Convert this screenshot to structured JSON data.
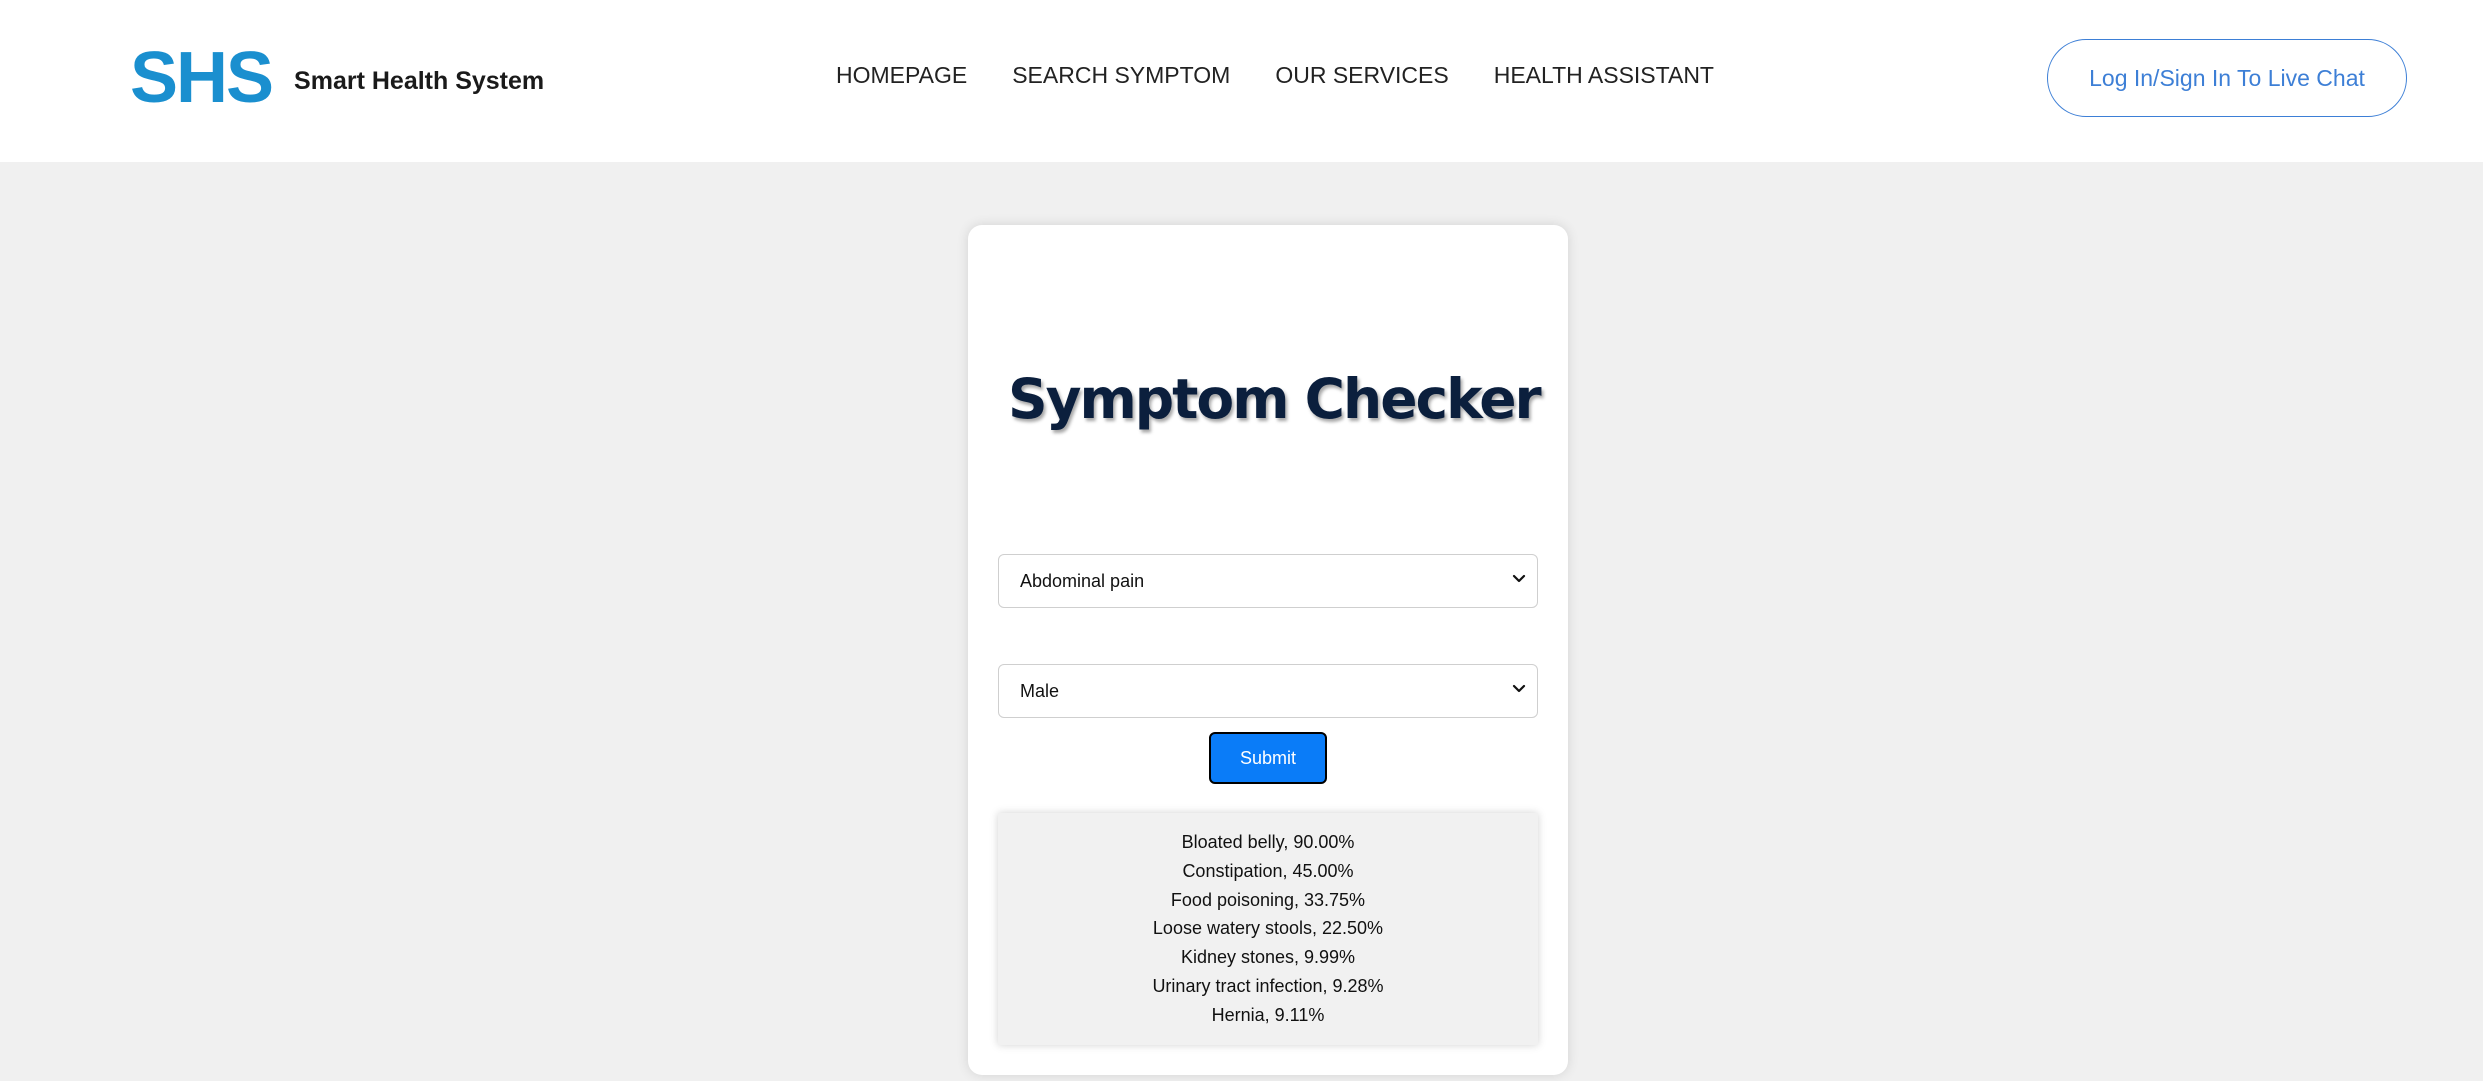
{
  "header": {
    "logo_mark": "SHS",
    "logo_text": "Smart Health System",
    "nav": [
      "HOMEPAGE",
      "SEARCH SYMPTOM",
      "OUR SERVICES",
      "HEALTH ASSISTANT"
    ],
    "login_label": "Log In/Sign In To Live Chat"
  },
  "checker": {
    "title": "Symptom Checker",
    "symptom_selected": "Abdominal pain",
    "gender_selected": "Male",
    "submit_label": "Submit",
    "results": [
      "Bloated belly, 90.00%",
      "Constipation, 45.00%",
      "Food poisoning, 33.75%",
      "Loose watery stools, 22.50%",
      "Kidney stones, 9.99%",
      "Urinary tract infection, 9.28%",
      "Hernia, 9.11%"
    ]
  },
  "icons": {
    "dropdown": "chevron-down-icon"
  },
  "colors": {
    "brand_blue": "#1a8fcf",
    "link_blue": "#3d7fd6",
    "submit_blue": "#0a7cf8",
    "title_navy": "#0b1f3d",
    "page_bg": "#f0f0f0"
  }
}
